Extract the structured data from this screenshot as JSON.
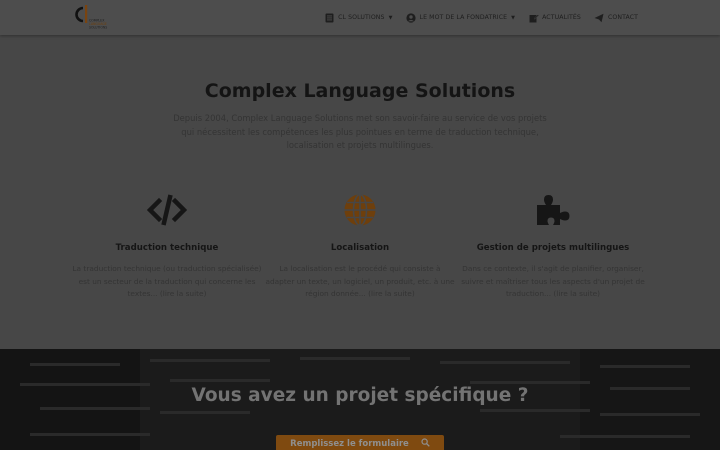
{
  "header": {
    "logo": {
      "name": "cl-logo",
      "text_lines": [
        "COMPLEX",
        "LANGUAGE",
        "SOLUTIONS"
      ]
    },
    "nav": [
      {
        "label": "CL SOLUTIONS",
        "icon": "document-icon",
        "dropdown": true
      },
      {
        "label": "LE MOT DE LA FONDATRICE",
        "icon": "user-circle-icon",
        "dropdown": true
      },
      {
        "label": "ACTUALITÉS",
        "icon": "edit-icon",
        "dropdown": false
      },
      {
        "label": "CONTACT",
        "icon": "send-icon",
        "dropdown": false
      }
    ]
  },
  "hero": {
    "title": "Complex Language Solutions",
    "description": "Depuis 2004, Complex Language Solutions met son savoir-faire au service de vos projets qui nécessitent les compétences les plus pointues en terme de traduction technique, localisation et projets multilingues."
  },
  "features": [
    {
      "icon": "code-icon",
      "title": "Traduction technique",
      "description": "La traduction technique (ou traduction spécialisée) est un secteur de la traduction qui concerne les textes... (lire la suite)"
    },
    {
      "icon": "globe-icon",
      "title": "Localisation",
      "description": "La localisation est le procédé qui consiste à adapter un texte, un logiciel, un produit, etc. à une région donnée... (lire la suite)"
    },
    {
      "icon": "puzzle-icon",
      "title": "Gestion de projets multilingues",
      "description": "Dans ce contexte, il s'agit de planifier, organiser, suivre et maîtriser tous les aspects d'un projet de traduction... (lire la suite)"
    }
  ],
  "banner": {
    "title": "Vous avez un projet spécifique ?",
    "cta_label": "Remplissez le formulaire",
    "cta_icon": "search-icon"
  },
  "colors": {
    "accent": "#7f4a10",
    "overlay_bg": "#474747",
    "icon_dark": "#161616",
    "icon_accent": "#6e3f0c"
  }
}
